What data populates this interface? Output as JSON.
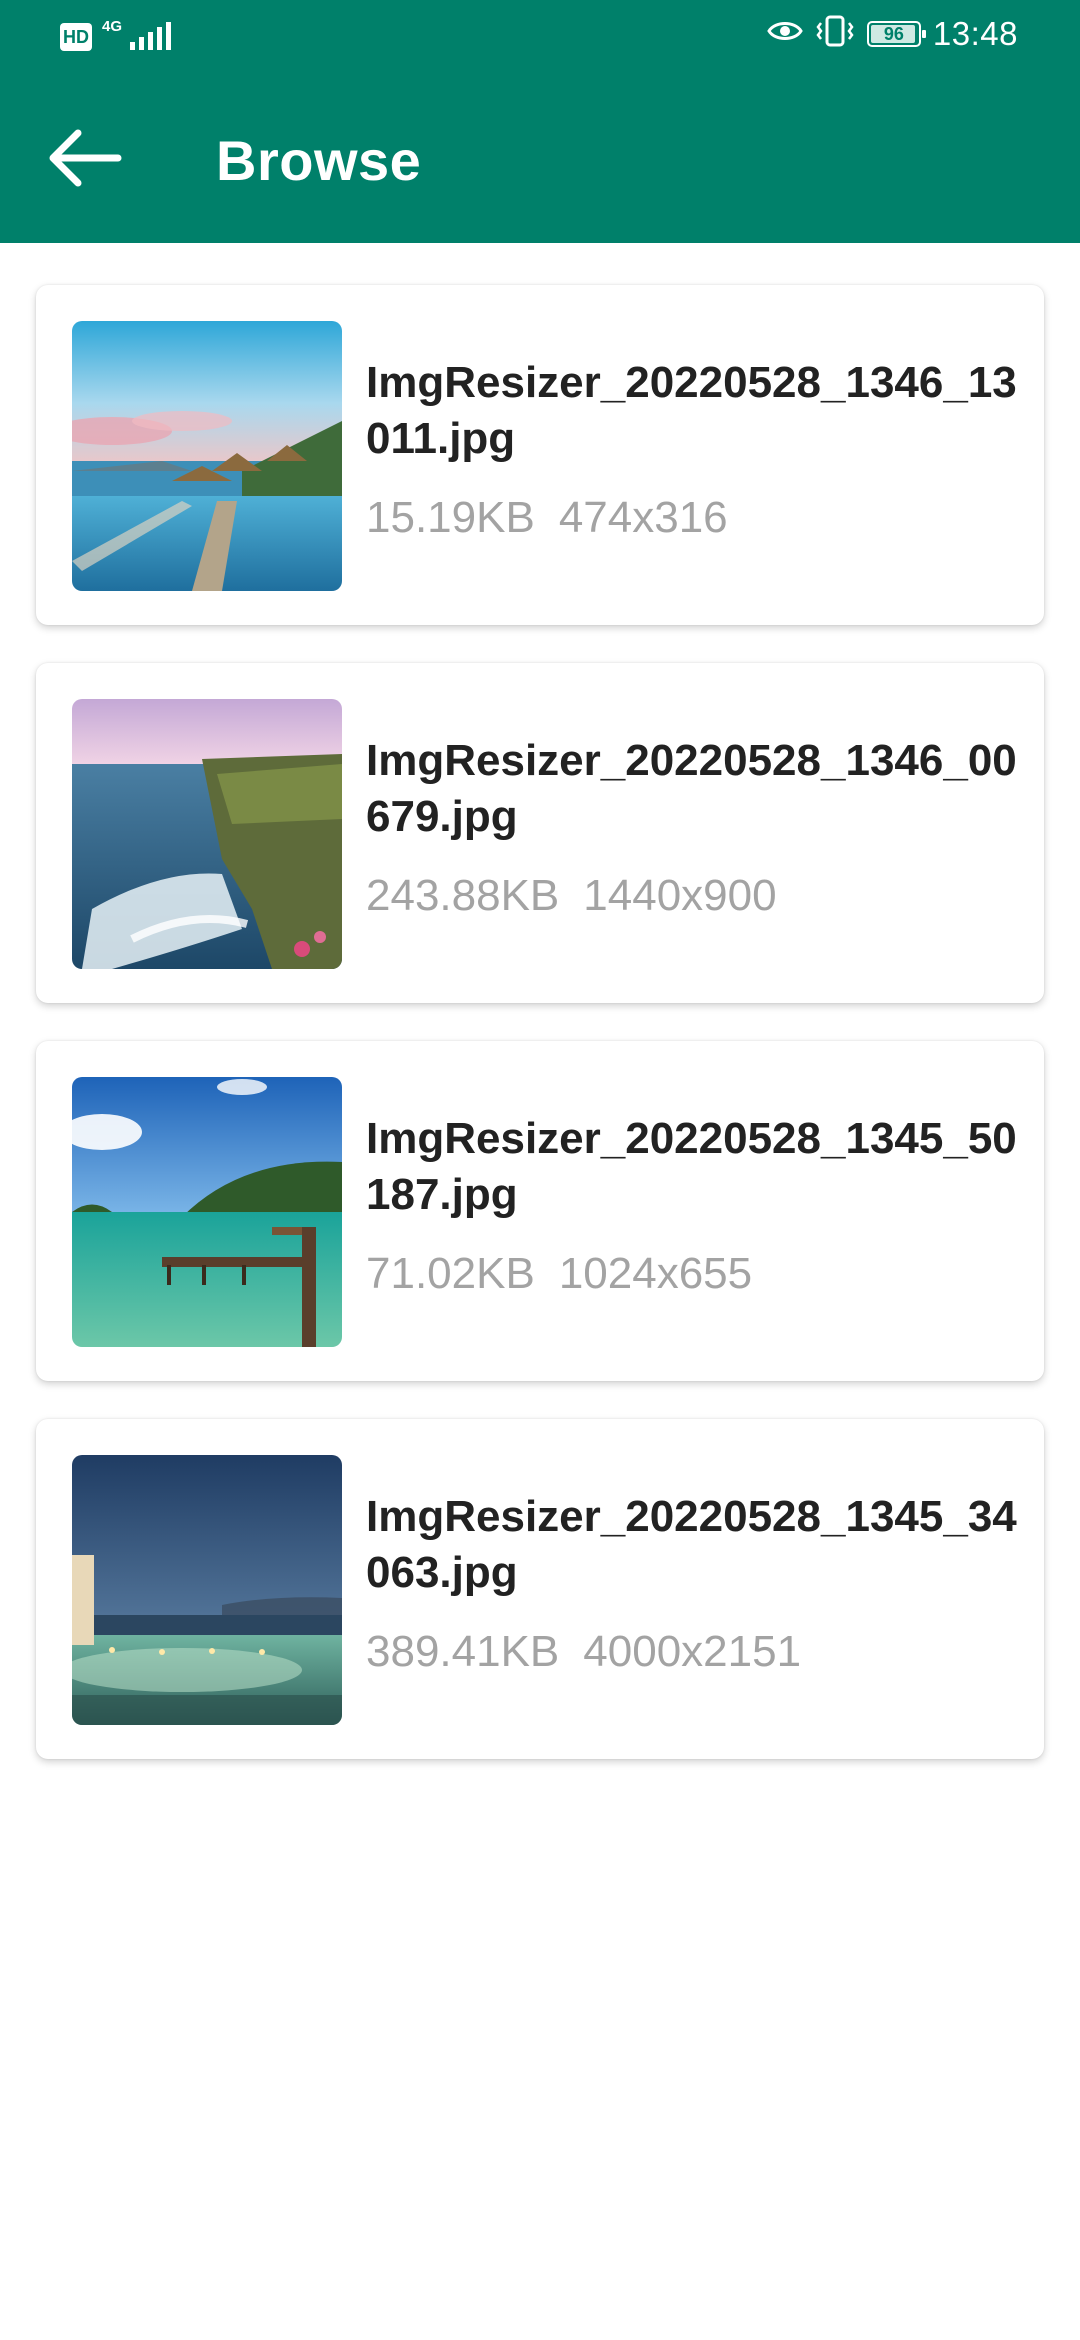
{
  "status_bar": {
    "hd_label": "HD",
    "network_label": "4G",
    "battery_level": "96",
    "time": "13:48"
  },
  "app_bar": {
    "title": "Browse",
    "back_icon": "arrow-left-icon"
  },
  "colors": {
    "primary": "#00806A",
    "title_text": "#222222",
    "meta_text": "#A3A3A3"
  },
  "files": [
    {
      "name": "ImgResizer_20220528_1346_13011.jpg",
      "size": "15.19KB",
      "dimensions": "474x316"
    },
    {
      "name": "ImgResizer_20220528_1346_00679.jpg",
      "size": "243.88KB",
      "dimensions": "1440x900"
    },
    {
      "name": "ImgResizer_20220528_1345_50187.jpg",
      "size": "71.02KB",
      "dimensions": "1024x655"
    },
    {
      "name": "ImgResizer_20220528_1345_34063.jpg",
      "size": "389.41KB",
      "dimensions": "4000x2151"
    }
  ]
}
